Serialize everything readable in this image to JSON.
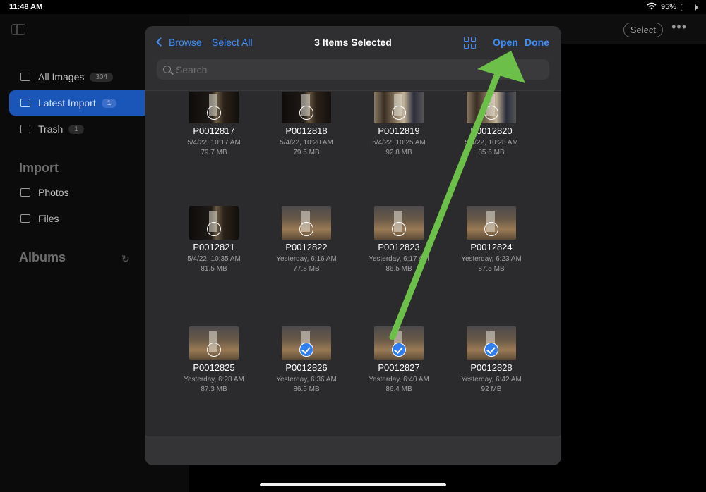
{
  "status": {
    "time": "11:48 AM",
    "battery": "95%"
  },
  "sidebar": {
    "items": [
      {
        "label": "All Images",
        "count": "304"
      },
      {
        "label": "Latest Import",
        "count": "1"
      },
      {
        "label": "Trash",
        "count": "1"
      }
    ],
    "import_title": "Import",
    "import_items": [
      {
        "label": "Photos"
      },
      {
        "label": "Files"
      }
    ],
    "albums_title": "Albums"
  },
  "topbar": {
    "select_label": "Select",
    "more_label": "•••"
  },
  "dialog": {
    "back_label": "Browse",
    "select_all_label": "Select All",
    "title": "3 Items Selected",
    "open_label": "Open",
    "done_label": "Done",
    "search_placeholder": "Search",
    "tiles": [
      {
        "name": "P0012817",
        "date": "5/4/22, 10:17 AM",
        "size": "79.7 MB"
      },
      {
        "name": "P0012818",
        "date": "5/4/22, 10:20 AM",
        "size": "79.5 MB"
      },
      {
        "name": "P0012819",
        "date": "5/4/22, 10:25 AM",
        "size": "92.8 MB"
      },
      {
        "name": "P0012820",
        "date": "5/4/22, 10:28 AM",
        "size": "85.6 MB"
      },
      {
        "name": "P0012821",
        "date": "5/4/22, 10:35 AM",
        "size": "81.5 MB"
      },
      {
        "name": "P0012822",
        "date": "Yesterday, 6:16 AM",
        "size": "77.8 MB"
      },
      {
        "name": "P0012823",
        "date": "Yesterday, 6:17 AM",
        "size": "86.5 MB"
      },
      {
        "name": "P0012824",
        "date": "Yesterday, 6:23 AM",
        "size": "87.5 MB"
      },
      {
        "name": "P0012825",
        "date": "Yesterday, 6:28 AM",
        "size": "87.3 MB"
      },
      {
        "name": "P0012826",
        "date": "Yesterday, 6:36 AM",
        "size": "86.5 MB"
      },
      {
        "name": "P0012827",
        "date": "Yesterday, 6:40 AM",
        "size": "86.4 MB"
      },
      {
        "name": "P0012828",
        "date": "Yesterday, 6:42 AM",
        "size": "92 MB"
      }
    ]
  },
  "colors": {
    "accent": "#3d8ef7",
    "active_nav": "#1a56b8",
    "annotation_arrow": "#6cc04a"
  }
}
